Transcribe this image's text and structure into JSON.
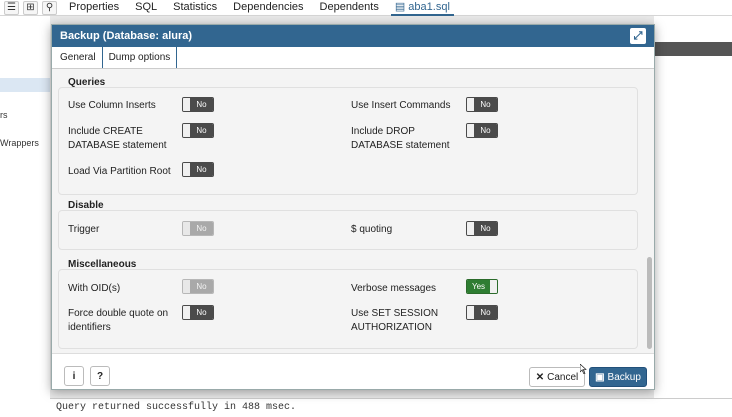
{
  "toolbar": {
    "tabs": [
      "Properties",
      "SQL",
      "Statistics",
      "Dependencies",
      "Dependents",
      "aba1.sql"
    ]
  },
  "left_panel": {
    "items": [
      "rs",
      "Wrappers"
    ]
  },
  "status_bar": {
    "message": "Query returned successfully in 488 msec."
  },
  "dialog": {
    "title": "Backup (Database: alura)",
    "tabs": [
      "General",
      "Dump options"
    ],
    "active_tab": "Dump options",
    "sections": {
      "queries": {
        "title": "Queries",
        "use_column_inserts": {
          "label": "Use Column Inserts",
          "value": "No"
        },
        "use_insert_commands": {
          "label": "Use Insert Commands",
          "value": "No"
        },
        "include_create_db": {
          "label_line1": "Include CREATE",
          "label_line2": "DATABASE statement",
          "value": "No"
        },
        "include_drop_db": {
          "label_line1": "Include DROP",
          "label_line2": "DATABASE statement",
          "value": "No"
        },
        "load_via_partition_root": {
          "label": "Load Via Partition Root",
          "value": "No"
        }
      },
      "disable": {
        "title": "Disable",
        "trigger": {
          "label": "Trigger",
          "value": "No",
          "disabled": true
        },
        "dollar_quoting": {
          "label": "$ quoting",
          "value": "No"
        }
      },
      "misc": {
        "title": "Miscellaneous",
        "with_oids": {
          "label": "With OID(s)",
          "value": "No",
          "disabled": true
        },
        "verbose_messages": {
          "label": "Verbose messages",
          "value": "Yes"
        },
        "force_double_quote": {
          "label_line1": "Force double quote on",
          "label_line2": "identifiers",
          "value": "No"
        },
        "use_set_session_auth": {
          "label_line1": "Use SET SESSION",
          "label_line2": "AUTHORIZATION",
          "value": "No"
        }
      }
    },
    "footer": {
      "info": "i",
      "help": "?",
      "cancel": "Cancel",
      "backup": "Backup"
    }
  },
  "colors": {
    "accent": "#326690",
    "toggle_on": "#2e7d32",
    "toggle_off": "#4b4b4b",
    "toggle_disabled": "#a9a9a9"
  }
}
